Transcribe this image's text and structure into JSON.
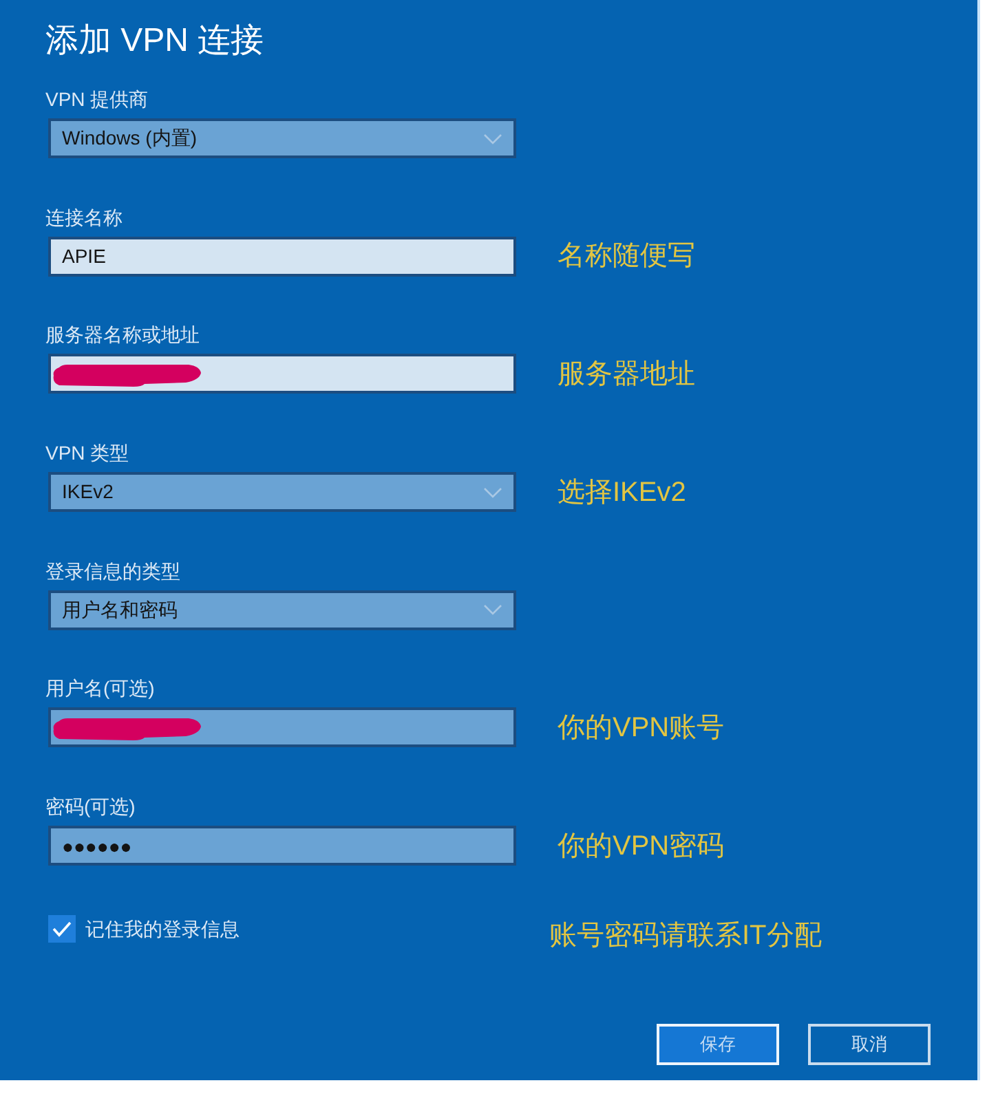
{
  "dialog": {
    "title": "添加 VPN 连接"
  },
  "fields": [
    {
      "kind": "dropdown",
      "label": "VPN 提供商",
      "value": "Windows (内置)"
    },
    {
      "kind": "textbox",
      "label": "连接名称",
      "value": "APIE",
      "highlighted": true,
      "note": "名称随便写"
    },
    {
      "kind": "textbox",
      "label": "服务器名称或地址",
      "redacted": true,
      "highlighted": true,
      "note": "服务器地址"
    },
    {
      "kind": "dropdown",
      "label": "VPN 类型",
      "value": "IKEv2",
      "note": "选择IKEv2"
    },
    {
      "kind": "dropdown",
      "label": "登录信息的类型",
      "value": "用户名和密码"
    },
    {
      "kind": "textbox",
      "label": "用户名(可选)",
      "redacted": true,
      "highlighted": false,
      "note": "你的VPN账号"
    },
    {
      "kind": "textbox",
      "label": "密码(可选)",
      "value": "●●●●●●",
      "highlighted": false,
      "note": "你的VPN密码"
    }
  ],
  "remember": {
    "label": "记住我的登录信息",
    "checked": true,
    "note": "账号密码请联系IT分配"
  },
  "buttons": [
    {
      "label": "保存",
      "primary": true
    },
    {
      "label": "取消",
      "primary": false
    }
  ]
}
